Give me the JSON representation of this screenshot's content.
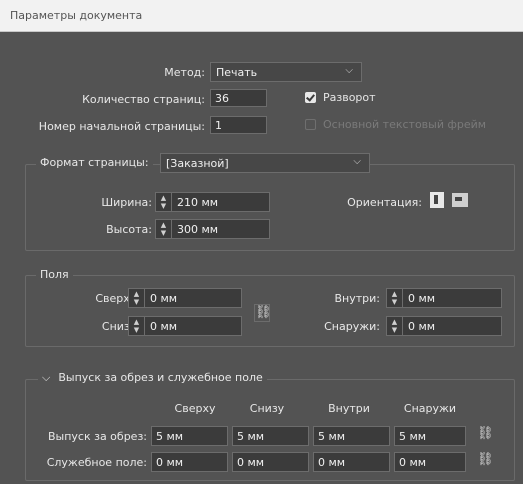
{
  "window": {
    "title": "Параметры документа"
  },
  "main": {
    "method_label": "Метод:",
    "method_value": "Печать",
    "pages_label": "Количество страниц:",
    "pages_value": "36",
    "start_page_label": "Номер начальной страницы:",
    "start_page_value": "1",
    "spread_label": "Разворот",
    "spread_checked": true,
    "primary_text_frame_label": "Основной текстовый фрейм",
    "primary_text_frame_checked": false
  },
  "page_format": {
    "label": "Формат страницы:",
    "value": "[Заказной]",
    "width_label": "Ширина:",
    "width_value": "210 мм",
    "height_label": "Высота:",
    "height_value": "300 мм",
    "orientation_label": "Ориентация:"
  },
  "margins": {
    "title": "Поля",
    "top_label": "Сверху:",
    "top_value": "0 мм",
    "bottom_label": "Снизу:",
    "bottom_value": "0 мм",
    "inside_label": "Внутри:",
    "inside_value": "0 мм",
    "outside_label": "Снаружи:",
    "outside_value": "0 мм"
  },
  "bleed": {
    "title": "Выпуск за обрез и служебное поле",
    "columns": [
      "Сверху",
      "Снизу",
      "Внутри",
      "Снаружи"
    ],
    "rows": [
      {
        "label": "Выпуск за обрез:",
        "values": [
          "5 мм",
          "5 мм",
          "5 мм",
          "5 мм"
        ]
      },
      {
        "label": "Служебное поле:",
        "values": [
          "0 мм",
          "0 мм",
          "0 мм",
          "0 мм"
        ]
      }
    ]
  },
  "colors": {
    "panel": "#535353",
    "field": "#3b3b3b",
    "titlebar": "#f2f2f2"
  }
}
